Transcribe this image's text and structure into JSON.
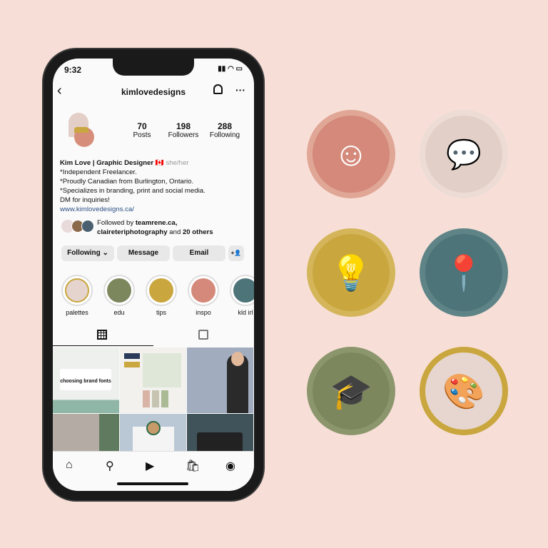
{
  "status": {
    "time": "9:32",
    "icons": "▮▮ ◠ ▭"
  },
  "header": {
    "username": "kimlovedesigns",
    "back": "‹",
    "more": "···"
  },
  "stats": [
    {
      "value": "70",
      "label": "Posts"
    },
    {
      "value": "198",
      "label": "Followers"
    },
    {
      "value": "288",
      "label": "Following"
    }
  ],
  "bio": {
    "name": "Kim Love | Graphic Designer",
    "flag": "🇨🇦",
    "pronouns": "she/her",
    "lines": [
      "*Independent Freelancer.",
      "*Proudly Canadian from Burlington, Ontario.",
      "*Specializes in branding, print and social media.",
      "DM for inquiries!"
    ],
    "link": "www.kimlovedesigns.ca/"
  },
  "followed": {
    "prefix": "Followed by ",
    "user1": "teamrene.ca,",
    "user2": "claireteriphotography",
    "mid": " and ",
    "others": "20 others"
  },
  "buttons": {
    "following": "Following ⌄",
    "message": "Message",
    "email": "Email",
    "add": "+👤"
  },
  "highlights": [
    {
      "label": "palettes",
      "color": "#e5d4cd",
      "ring": "#c9a63e"
    },
    {
      "label": "edu",
      "color": "#7d875e"
    },
    {
      "label": "tips",
      "color": "#c9a63e"
    },
    {
      "label": "inspo",
      "color": "#d4897a"
    },
    {
      "label": "kld irl",
      "color": "#4d7478"
    }
  ],
  "grid_text": {
    "post1": "choosing brand fonts"
  },
  "colors": {
    "background": "#f7dfd7",
    "inspo": "#d4897a",
    "chat": "#e2d0c8",
    "tips": "#c9a63e",
    "location": "#4d7478",
    "edu": "#7d875e",
    "palettes": "#e6d6cf"
  },
  "icons": {
    "inspo": "head-swirl-icon",
    "chat": "chat-heart-icon",
    "tips": "lightbulb-icon",
    "location": "map-pin-globe-icon",
    "edu": "graduation-cap-icon",
    "palettes": "color-swatch-icon"
  }
}
